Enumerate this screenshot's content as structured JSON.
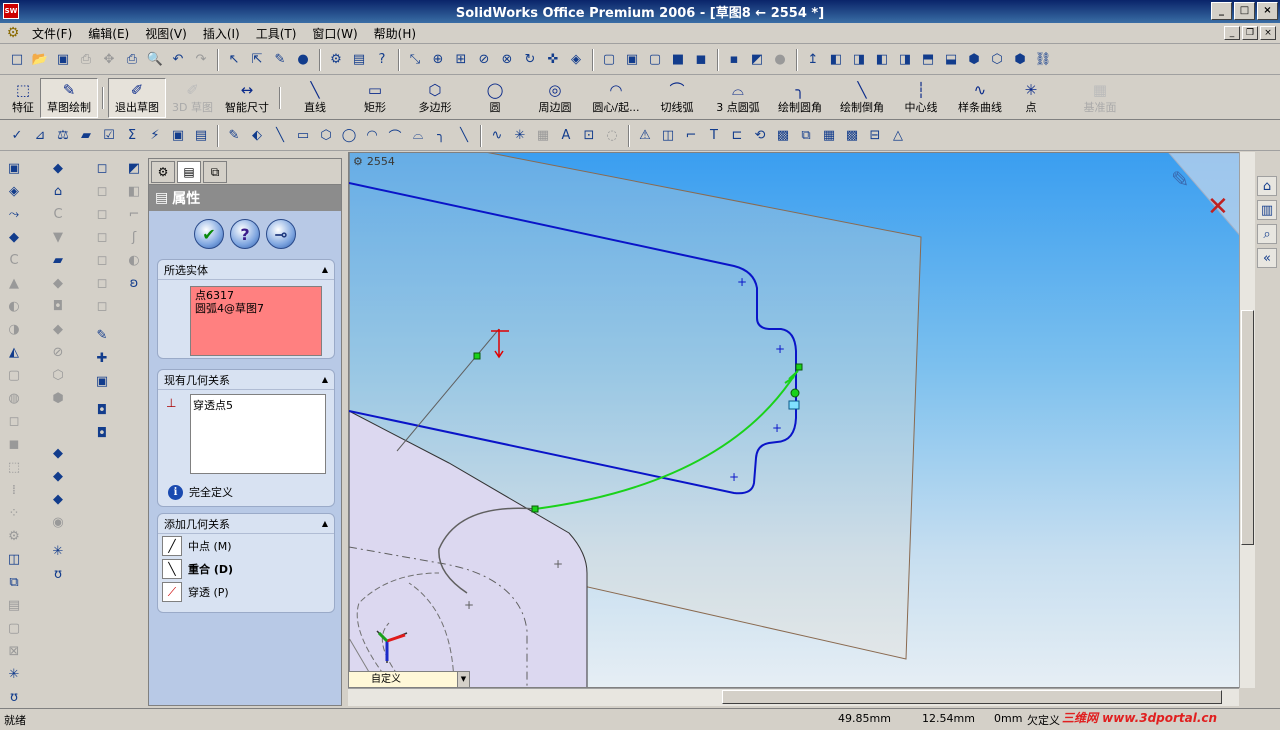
{
  "window": {
    "title": "SolidWorks Office Premium 2006 - [草图8 ← 2554 *]",
    "app_icon": "SW"
  },
  "menu": [
    "文件(F)",
    "编辑(E)",
    "视图(V)",
    "插入(I)",
    "工具(T)",
    "窗口(W)",
    "帮助(H)"
  ],
  "commands": {
    "feature": "特征",
    "sketch_draw": "草图绘制",
    "exit_sketch": "退出草图",
    "sketch3d": "3D 草图",
    "smart_dim": "智能尺寸",
    "line": "直线",
    "rect": "矩形",
    "polygon": "多边形",
    "circle": "圆",
    "perim_circle": "周边圆",
    "center_arc": "圆心/起...",
    "tangent_arc": "切线弧",
    "three_pt_arc": "3 点圆弧",
    "fillet": "绘制圆角",
    "chamfer": "绘制倒角",
    "centerline": "中心线",
    "spline": "样条曲线",
    "point": "点",
    "ref_plane": "基准面"
  },
  "viewport": {
    "doc_name": "2554",
    "view_orientation": "自定义"
  },
  "property_manager": {
    "title": "属性",
    "selected_entities": {
      "title": "所选实体",
      "items": [
        "点6317",
        "圆弧4@草图7"
      ]
    },
    "existing_relations": {
      "title": "现有几何关系",
      "items": [
        "穿透点5"
      ],
      "status": "完全定义"
    },
    "add_relations": {
      "title": "添加几何关系",
      "items": [
        "中点 (M)",
        "重合 (D)",
        "穿透 (P)"
      ]
    }
  },
  "status": {
    "left": "就绪",
    "x": "49.85mm",
    "y": "12.54mm",
    "z": "0mm",
    "state": "欠定义"
  },
  "watermark": "三维网 www.3dportal.cn"
}
